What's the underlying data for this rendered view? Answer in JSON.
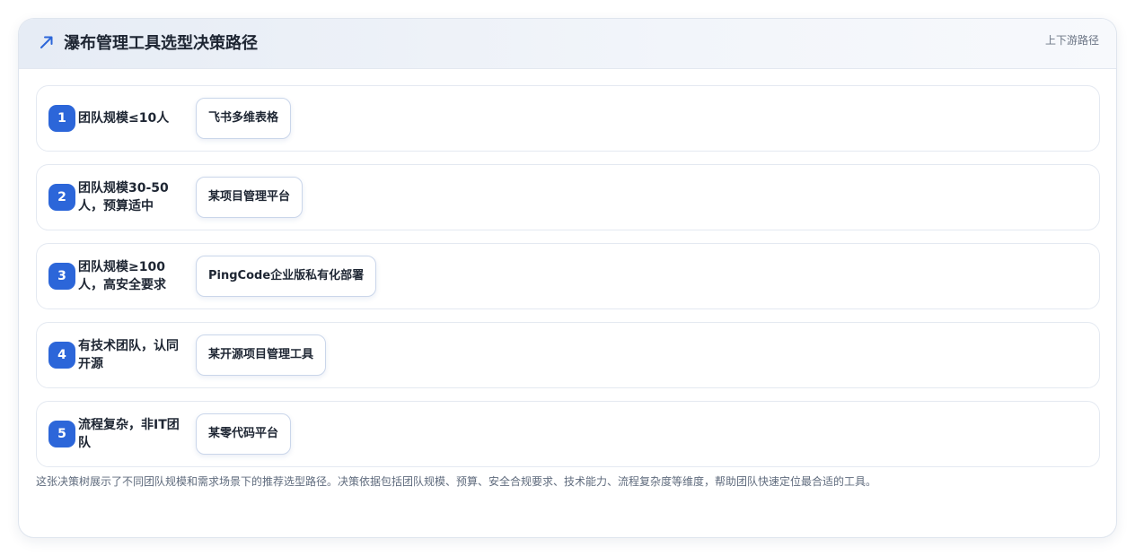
{
  "header": {
    "title": "瀑布管理工具选型决策路径",
    "tag": "上下游路径"
  },
  "steps": [
    {
      "number": "1",
      "condition": "团队规模≤10人",
      "tool": "飞书多维表格"
    },
    {
      "number": "2",
      "condition": "团队规模30-50人，预算适中",
      "tool": "某项目管理平台"
    },
    {
      "number": "3",
      "condition": "团队规模≥100人，高安全要求",
      "tool": "PingCode企业版私有化部署"
    },
    {
      "number": "4",
      "condition": "有技术团队，认同开源",
      "tool": "某开源项目管理工具"
    },
    {
      "number": "5",
      "condition": "流程复杂，非IT团队",
      "tool": "某零代码平台"
    }
  ],
  "footnote": "这张决策树展示了不同团队规模和需求场景下的推荐选型路径。决策依据包括团队规模、预算、安全合规要求、技术能力、流程复杂度等维度，帮助团队快速定位最合适的工具。",
  "colors": {
    "accent": "#2c66d9",
    "title_text": "#1e2633",
    "muted_text": "#6b7585"
  }
}
